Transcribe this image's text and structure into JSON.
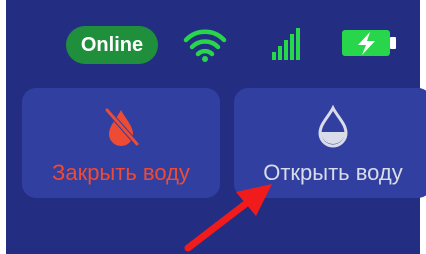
{
  "status_bar": {
    "online_label": "Online",
    "icons": [
      "wifi-icon",
      "signal-icon",
      "battery-charging-icon"
    ]
  },
  "buttons": {
    "close_water": {
      "label": "Закрыть воду",
      "icon": "water-drop-off-icon",
      "color": "#ee4b35"
    },
    "open_water": {
      "label": "Открыть воду",
      "icon": "water-drop-icon",
      "color": "#d9dce9"
    }
  },
  "colors": {
    "background": "#232e82",
    "button": "#313fa0",
    "online": "#1f8f3c",
    "accent_green": "#27d64a",
    "arrow": "#f21b1b"
  }
}
